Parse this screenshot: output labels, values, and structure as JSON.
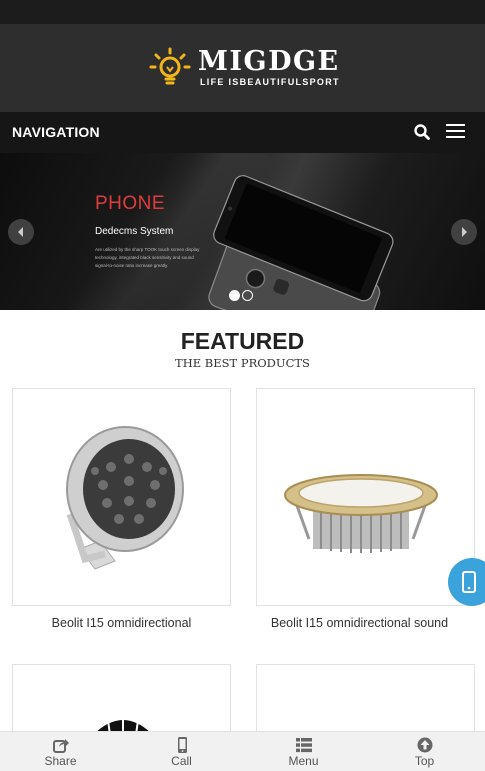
{
  "brand": {
    "title": "MIGDGE",
    "tagline": "LIFE ISBEAUTIFULSPORT",
    "accent_color": "#f2b51c",
    "icon": "lightbulb-icon"
  },
  "nav": {
    "title": "NAVIGATION",
    "search_icon": "search-icon",
    "menu_icon": "hamburger-icon"
  },
  "banner": {
    "heading": "PHONE",
    "subheading": "Dedecms System",
    "description": "Are utilized by the sharp TOOK touch screen display technology, integrated black sensitivity and sound signal-to-noise ratio increase greatly.",
    "heading_color": "#e03c3c",
    "slides": 2,
    "active_slide": 1
  },
  "featured": {
    "title": "FEATURED",
    "subtitle": "THE BEST PRODUCTS",
    "products": [
      {
        "caption": "Beolit I15 omnidirectional"
      },
      {
        "caption": "Beolit I15 omnidirectional sound"
      },
      {
        "caption": ""
      },
      {
        "caption": ""
      }
    ]
  },
  "float_button": {
    "icon": "mobile-phone-icon",
    "color": "#3aa3dc"
  },
  "footer": {
    "items": [
      {
        "label": "Share",
        "icon": "share-icon"
      },
      {
        "label": "Call",
        "icon": "phone-icon"
      },
      {
        "label": "Menu",
        "icon": "list-icon"
      },
      {
        "label": "Top",
        "icon": "arrow-up-icon"
      }
    ]
  }
}
